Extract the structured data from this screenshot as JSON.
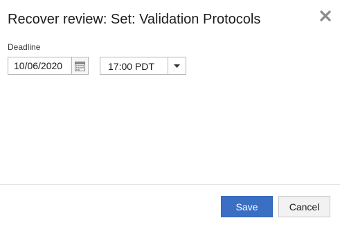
{
  "dialog": {
    "title": "Recover review: Set: Validation Protocols",
    "close_icon": "close-x-icon"
  },
  "deadline": {
    "label": "Deadline",
    "date_value": "10/06/2020",
    "calendar_icon": "calendar-icon",
    "time_value": "17:00 PDT",
    "dropdown_icon": "caret-down-icon"
  },
  "footer": {
    "save_label": "Save",
    "cancel_label": "Cancel"
  },
  "colors": {
    "primary": "#3b6fc3",
    "secondary_bg": "#f2f2f2",
    "border": "#b5b5b5"
  }
}
